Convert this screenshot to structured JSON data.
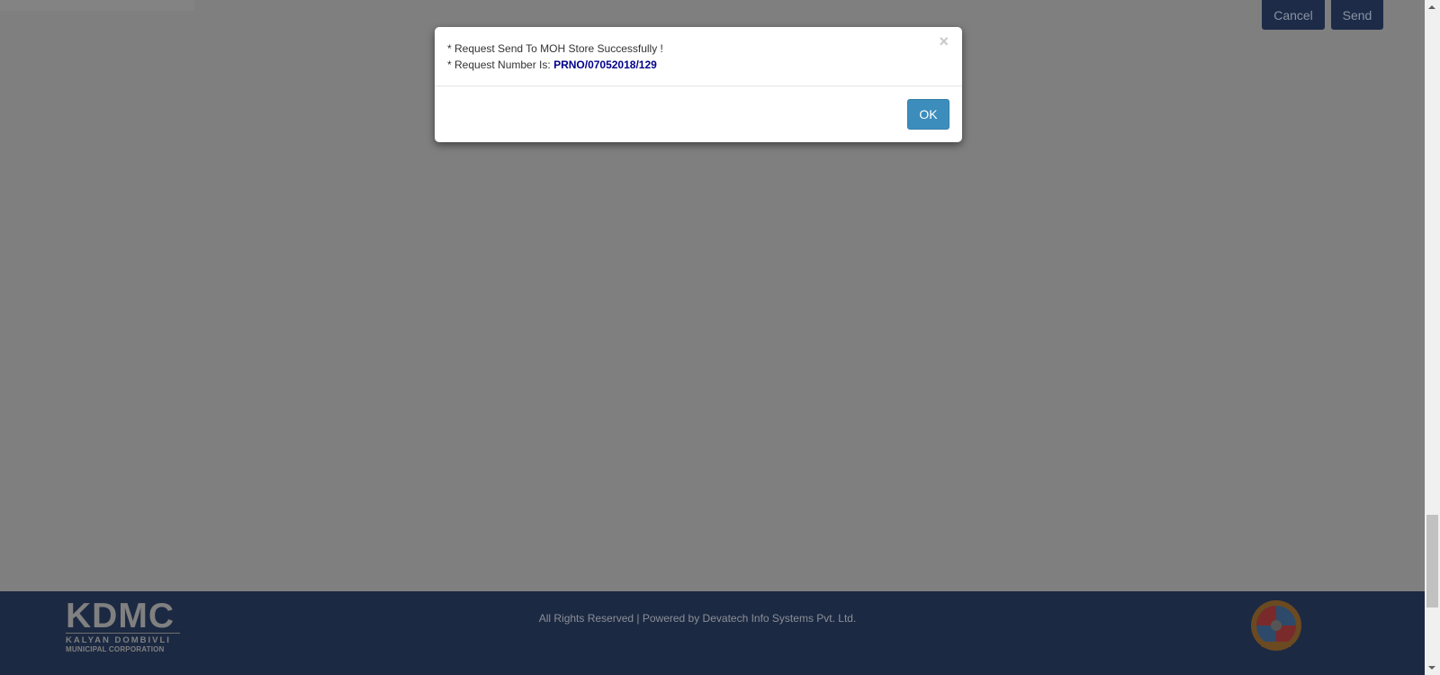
{
  "toolbar": {
    "cancel_label": "Cancel",
    "send_label": "Send"
  },
  "modal": {
    "line1": "* Request Send To MOH Store Successfully !",
    "line2_prefix": "* Request Number Is: ",
    "request_number": "PRNO/07052018/129",
    "close_symbol": "×",
    "ok_label": "OK"
  },
  "footer": {
    "logo_title": "KDMC",
    "logo_line1": "KALYAN DOMBIVLI",
    "logo_line2": "MUNICIPAL CORPORATION",
    "copyright": "All Rights Reserved | Powered by Devatech Info Systems Pvt. Ltd."
  }
}
